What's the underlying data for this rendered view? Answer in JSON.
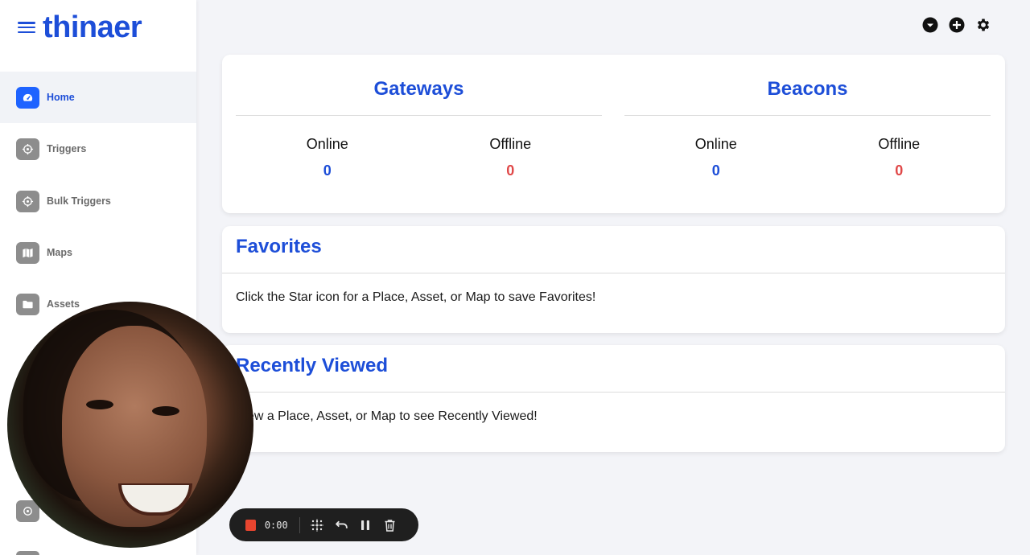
{
  "app": {
    "logo": "thinaer"
  },
  "sidebar": {
    "items": [
      {
        "label": "Home",
        "icon": "dashboard-icon",
        "active": true
      },
      {
        "label": "Triggers",
        "icon": "crosshair-icon",
        "active": false
      },
      {
        "label": "Bulk Triggers",
        "icon": "crosshair-icon",
        "active": false
      },
      {
        "label": "Maps",
        "icon": "map-icon",
        "active": false
      },
      {
        "label": "Assets",
        "icon": "folder-icon",
        "active": false
      }
    ]
  },
  "header": {
    "icons": [
      "chevron-down-circle-icon",
      "plus-circle-icon",
      "gear-icon"
    ]
  },
  "stats": {
    "gateways": {
      "title": "Gateways",
      "online_label": "Online",
      "online_value": "0",
      "offline_label": "Offline",
      "offline_value": "0"
    },
    "beacons": {
      "title": "Beacons",
      "online_label": "Online",
      "online_value": "0",
      "offline_label": "Offline",
      "offline_value": "0"
    }
  },
  "favorites": {
    "title": "Favorites",
    "text": "Click the Star icon for a Place, Asset, or Map to save Favorites!"
  },
  "recent": {
    "title": "Recently Viewed",
    "text": "View a Place, Asset, or Map to see Recently Viewed!"
  },
  "recorder": {
    "time": "0:00"
  },
  "colors": {
    "brand": "#1d4ed8",
    "active_icon": "#1e63ff",
    "offline": "#e04848",
    "record": "#e8452f"
  }
}
